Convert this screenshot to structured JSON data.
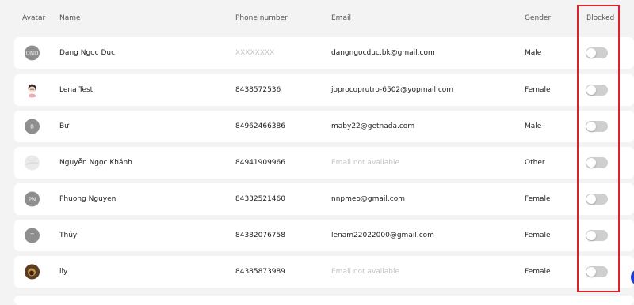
{
  "headers": {
    "avatar": "Avatar",
    "name": "Name",
    "phone": "Phone number",
    "email": "Email",
    "gender": "Gender",
    "blocked": "Blocked"
  },
  "rows": [
    {
      "avatar_text": "DND",
      "avatar_type": "initials",
      "name": "Dang Ngoc Duc",
      "phone": "XXXXXXXX",
      "phone_muted": true,
      "email": "dangngocduc.bk@gmail.com",
      "email_muted": false,
      "gender": "Male",
      "blocked": false
    },
    {
      "avatar_text": "",
      "avatar_type": "cartoon-girl",
      "name": "Lena Test",
      "phone": "8438572536",
      "phone_muted": false,
      "email": "joprocoprutro-6502@yopmail.com",
      "email_muted": false,
      "gender": "Female",
      "blocked": false
    },
    {
      "avatar_text": "B",
      "avatar_type": "initials",
      "name": "Bư",
      "phone": "84962466386",
      "phone_muted": false,
      "email": "maby22@getnada.com",
      "email_muted": false,
      "gender": "Male",
      "blocked": false
    },
    {
      "avatar_text": "",
      "avatar_type": "marble",
      "name": "Nguyễn Ngọc Khánh",
      "phone": "84941909966",
      "phone_muted": false,
      "email": "Email not available",
      "email_muted": true,
      "gender": "Other",
      "blocked": false
    },
    {
      "avatar_text": "PN",
      "avatar_type": "initials",
      "name": "Phuong Nguyen",
      "phone": "84332521460",
      "phone_muted": false,
      "email": "nnpmeo@gmail.com",
      "email_muted": false,
      "gender": "Female",
      "blocked": false
    },
    {
      "avatar_text": "T",
      "avatar_type": "initials",
      "name": "Thủy",
      "phone": "84382076758",
      "phone_muted": false,
      "email": "lenam22022000@gmail.com",
      "email_muted": false,
      "gender": "Female",
      "blocked": false
    },
    {
      "avatar_text": "",
      "avatar_type": "photo",
      "name": "ily",
      "phone": "84385873989",
      "phone_muted": false,
      "email": "Email not available",
      "email_muted": true,
      "gender": "Female",
      "blocked": false
    }
  ],
  "colors": {
    "highlight": "#d9232a",
    "toggle_off": "#cfcfcf",
    "avatar_bg": "#8e8e8e",
    "muted_text": "#c4c4c4"
  }
}
